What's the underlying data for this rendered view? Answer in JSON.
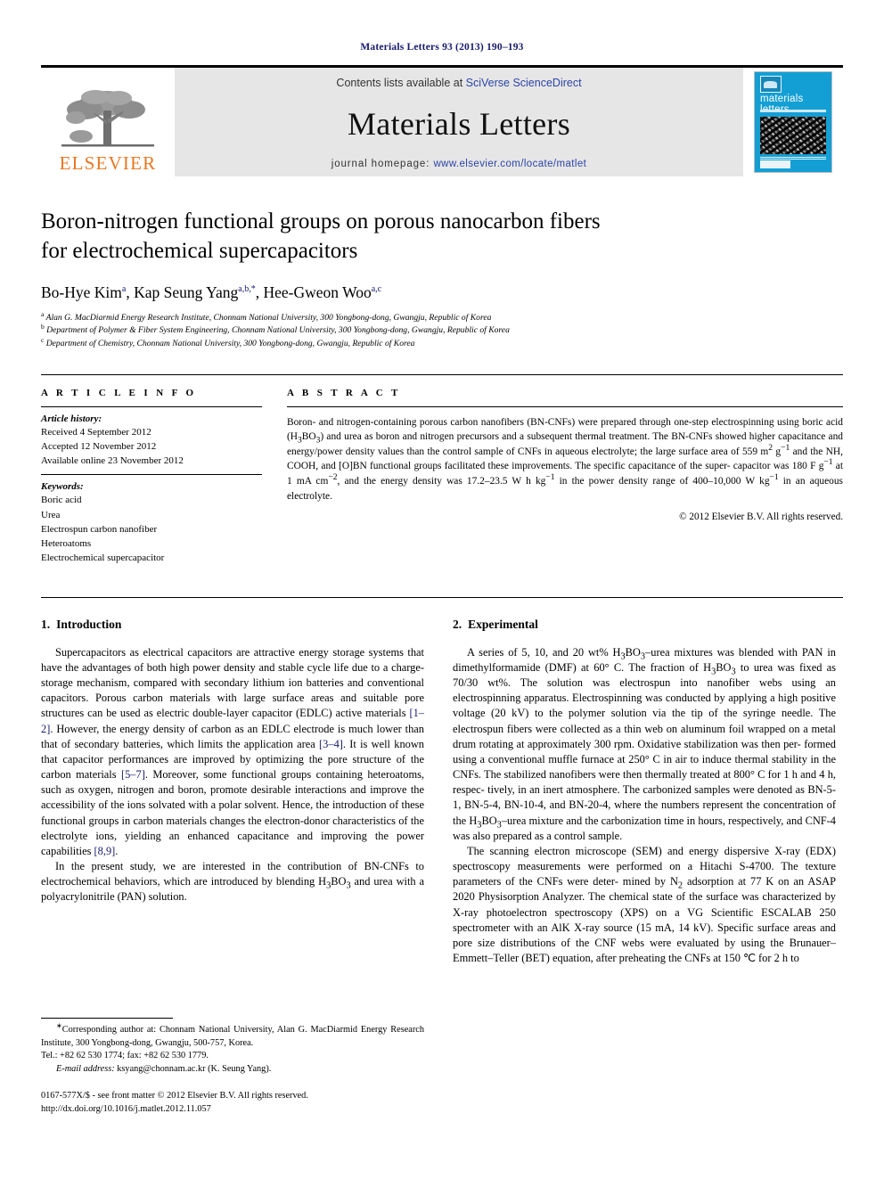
{
  "running_head": "Materials Letters 93 (2013) 190–193",
  "masthead": {
    "publisher_wordmark": "ELSEVIER",
    "contents_prefix": "Contents lists available at ",
    "contents_link": "SciVerse ScienceDirect",
    "journal_name": "Materials Letters",
    "homepage_prefix": "journal homepage: ",
    "homepage_url": "www.elsevier.com/locate/matlet",
    "cover_title": "materials letters"
  },
  "article": {
    "title_line1": "Boron-nitrogen functional groups on porous nanocarbon fibers",
    "title_line2": "for electrochemical supercapacitors",
    "authors": [
      {
        "name": "Bo-Hye Kim",
        "marks": "a"
      },
      {
        "name": "Kap Seung Yang",
        "marks": "a,b,*"
      },
      {
        "name": "Hee-Gweon Woo",
        "marks": "a,c"
      }
    ],
    "affiliations": [
      {
        "mark": "a",
        "text": "Alan G. MacDiarmid Energy Research Institute, Chonnam National University, 300 Yongbong-dong, Gwangju, Republic of Korea"
      },
      {
        "mark": "b",
        "text": "Department of Polymer & Fiber System Engineering, Chonnam National University, 300 Yongbong-dong, Gwangju, Republic of Korea"
      },
      {
        "mark": "c",
        "text": "Department of Chemistry, Chonnam National University, 300 Yongbong-dong, Gwangju, Republic of Korea"
      }
    ]
  },
  "article_info": {
    "heading": "A R T I C L E   I N F O",
    "history_label": "Article history:",
    "history": [
      "Received 4 September 2012",
      "Accepted 12 November 2012",
      "Available online 23 November 2012"
    ],
    "keywords_label": "Keywords:",
    "keywords": [
      "Boric acid",
      "Urea",
      "Electrospun carbon nanofiber",
      "Heteroatoms",
      "Electrochemical supercapacitor"
    ]
  },
  "abstract": {
    "heading": "A B S T R A C T",
    "copyright": "© 2012 Elsevier B.V. All rights reserved."
  },
  "sections": {
    "introduction": {
      "number": "1.",
      "title": "Introduction"
    },
    "experimental": {
      "number": "2.",
      "title": "Experimental"
    }
  },
  "footnotes": {
    "corresponding": "Corresponding author at: Chonnam National University, Alan G. MacDiarmid Energy Research Institute, 300 Yongbong-dong, Gwangju, 500-757, Korea.",
    "tel": "Tel.: +82 62 530 1774; fax: +82 62 530 1779.",
    "email_label": "E-mail address:",
    "email": "ksyang@chonnam.ac.kr (K. Seung Yang).",
    "issn_line": "0167-577X/$ - see front matter © 2012 Elsevier B.V. All rights reserved.",
    "doi_line": "http://dx.doi.org/10.1016/j.matlet.2012.11.057"
  },
  "colors": {
    "link_blue": "#2b44a8",
    "header_navy": "#16186b",
    "elsevier_orange": "#E87722",
    "cover_cyan": "#139fd4",
    "band_gray": "#e6e6e6"
  }
}
